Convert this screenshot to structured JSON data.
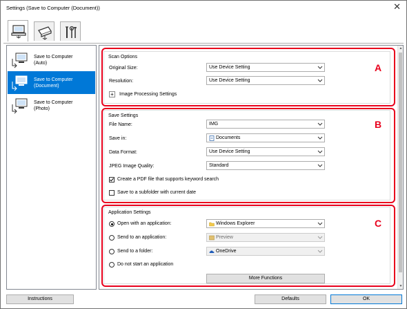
{
  "window": {
    "title": "Settings (Save to Computer (Document))",
    "close_glyph": "✕"
  },
  "tabs": [
    {
      "name": "scan-from-computer-tab",
      "icon": "computer-scan-icon"
    },
    {
      "name": "scan-from-operation-panel-tab",
      "icon": "scanner-icon"
    },
    {
      "name": "general-settings-tab",
      "icon": "tools-icon"
    }
  ],
  "sidebar": {
    "items": [
      {
        "label1": "Save to Computer",
        "label2": "(Auto)",
        "selected": false
      },
      {
        "label1": "Save to Computer",
        "label2": "(Document)",
        "selected": true
      },
      {
        "label1": "Save to Computer",
        "label2": "(Photo)",
        "selected": false
      }
    ]
  },
  "scan_options": {
    "title": "Scan Options",
    "original_size_label": "Original Size:",
    "original_size_value": "Use Device Setting",
    "resolution_label": "Resolution:",
    "resolution_value": "Use Device Setting",
    "image_processing_label": "Image Processing Settings",
    "plus_glyph": "+",
    "marker": "A"
  },
  "save_settings": {
    "title": "Save Settings",
    "file_name_label": "File Name:",
    "file_name_value": "IMG",
    "save_in_label": "Save in:",
    "save_in_value": "Documents",
    "data_format_label": "Data Format:",
    "data_format_value": "Use Device Setting",
    "jpeg_quality_label": "JPEG Image Quality:",
    "jpeg_quality_value": "Standard",
    "pdf_keyword_label": "Create a PDF file that supports keyword search",
    "pdf_keyword_checked": true,
    "subfolder_label": "Save to a subfolder with current date",
    "subfolder_checked": false,
    "marker": "B"
  },
  "application_settings": {
    "title": "Application Settings",
    "open_app_label": "Open with an application:",
    "open_app_value": "Windows Explorer",
    "send_app_label": "Send to an application:",
    "send_app_value": "Preview",
    "send_folder_label": "Send to a folder:",
    "send_folder_value": "OneDrive",
    "do_not_start_label": "Do not start an application",
    "selected_option": "open_app",
    "more_functions_label": "More Functions",
    "marker": "C"
  },
  "footer": {
    "instructions_label": "Instructions",
    "defaults_label": "Defaults",
    "ok_label": "OK"
  }
}
